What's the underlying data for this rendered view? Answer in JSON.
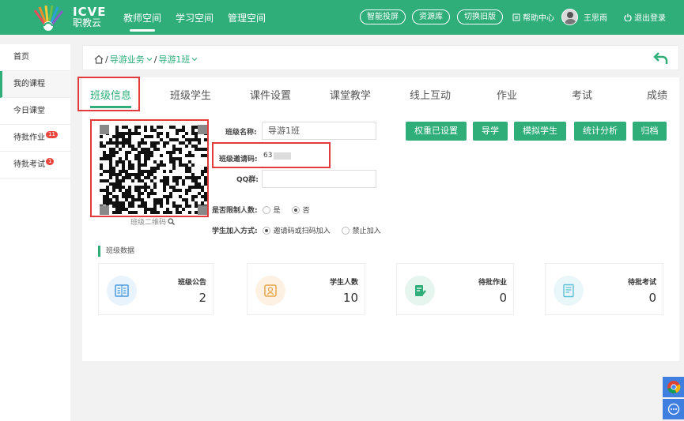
{
  "header": {
    "brand_en": "ICVE",
    "brand_cn": "职教云",
    "nav": [
      "教师空间",
      "学习空间",
      "管理空间"
    ],
    "pills": [
      "智能投屏",
      "资源库",
      "切换旧版"
    ],
    "help": "帮助中心",
    "user": "王思雨",
    "logout": "退出登录"
  },
  "sidebar": {
    "items": [
      {
        "label": "首页"
      },
      {
        "label": "我的课程"
      },
      {
        "label": "今日课堂"
      },
      {
        "label": "待批作业",
        "badge": "11"
      },
      {
        "label": "待批考试",
        "badge": "1"
      }
    ]
  },
  "breadcrumb": {
    "sep1": "/",
    "item1": "导游业务",
    "sep2": "/",
    "item2": "导游1班"
  },
  "tabs": [
    "班级信息",
    "班级学生",
    "课件设置",
    "课堂教学",
    "线上互动",
    "作业",
    "考试",
    "成绩"
  ],
  "form": {
    "class_name_label": "班级名称:",
    "class_name_value": "导游1班",
    "invite_label": "班级邀请码:",
    "invite_value": "63",
    "qq_label": "QQ群:",
    "qq_value": "",
    "limit_label": "是否限制人数:",
    "limit_yes": "是",
    "limit_no": "否",
    "join_label": "学生加入方式:",
    "join_opt1": "邀请码或扫码加入",
    "join_opt2": "禁止加入",
    "qr_caption": "班级二维码"
  },
  "actions": [
    "权重已设置",
    "导学",
    "模拟学生",
    "统计分析",
    "归档"
  ],
  "stats": {
    "title": "班级数据",
    "cards": [
      {
        "label": "班级公告",
        "value": "2"
      },
      {
        "label": "学生人数",
        "value": "10"
      },
      {
        "label": "待批作业",
        "value": "0"
      },
      {
        "label": "待批考试",
        "value": "0"
      }
    ]
  },
  "colors": {
    "accent": "#2fae7a",
    "highlight": "#e23b3b"
  }
}
